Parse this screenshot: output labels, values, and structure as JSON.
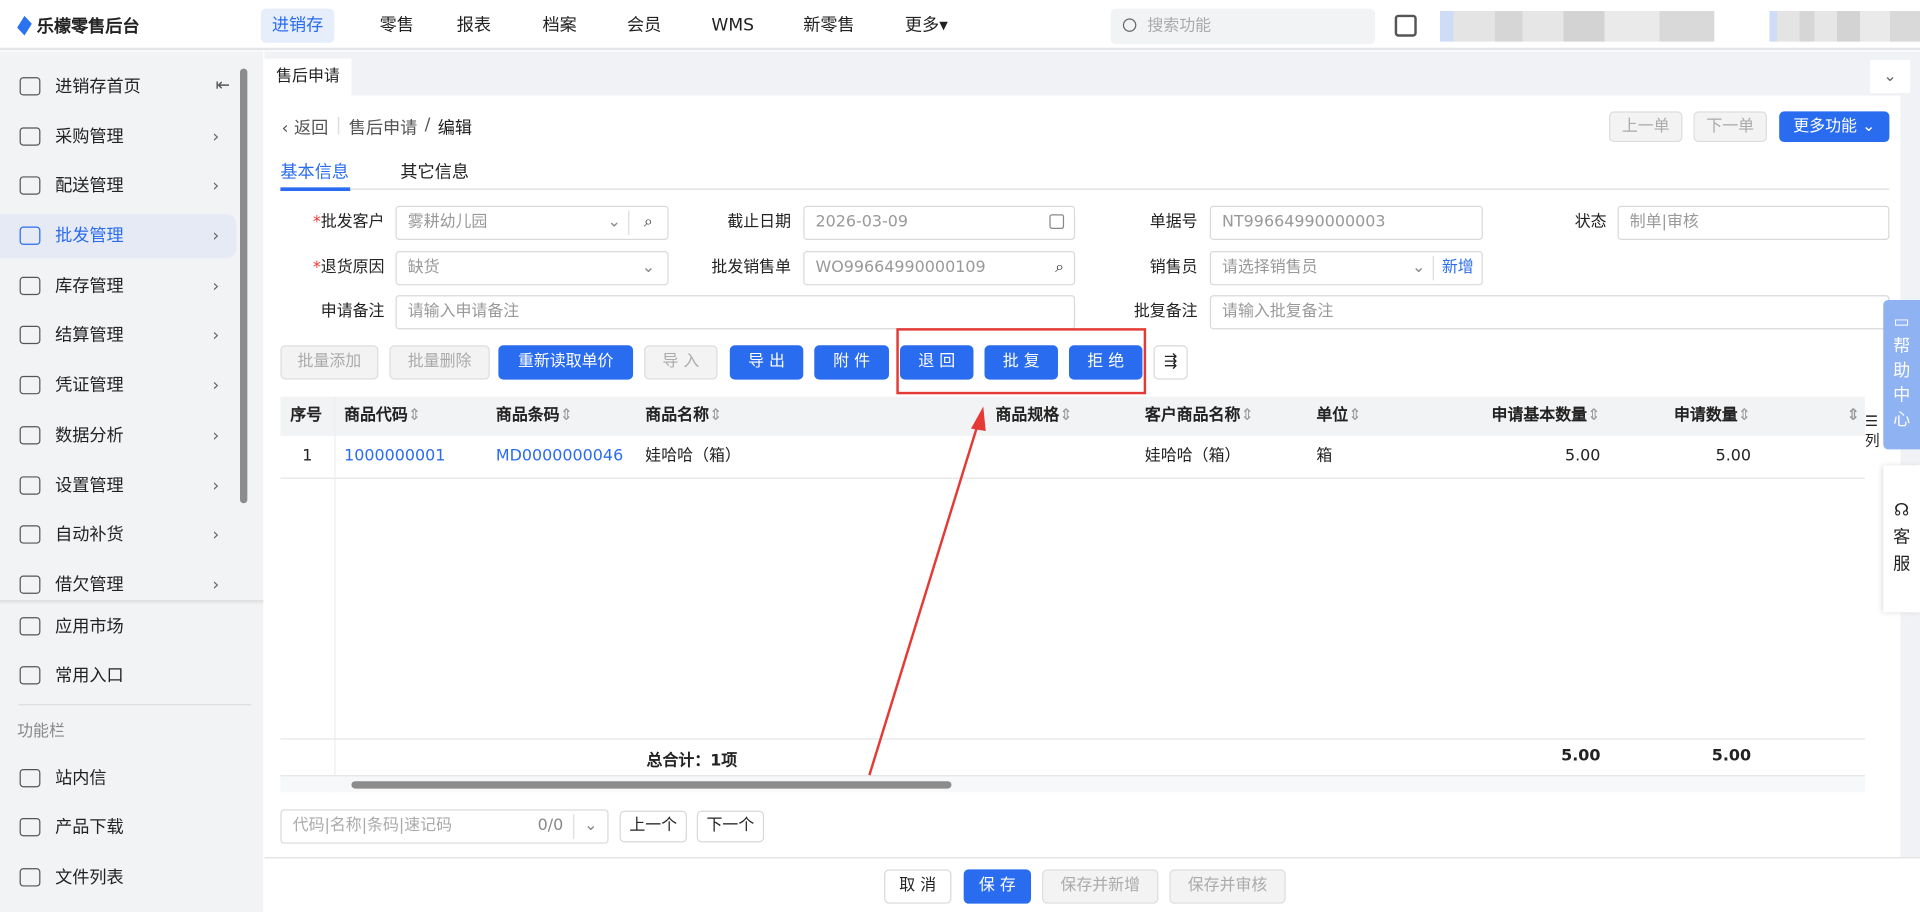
{
  "app": {
    "title": "乐檬零售后台",
    "search_placeholder": "搜索功能"
  },
  "topnav": [
    {
      "label": "进销存",
      "active": true
    },
    {
      "label": "零售"
    },
    {
      "label": "报表"
    },
    {
      "label": "档案"
    },
    {
      "label": "会员"
    },
    {
      "label": "WMS"
    },
    {
      "label": "新零售"
    },
    {
      "label": "更多▾"
    }
  ],
  "sidebar": {
    "items": [
      {
        "label": "进销存首页",
        "icon": "home-icon"
      },
      {
        "label": "采购管理",
        "icon": "cart-icon"
      },
      {
        "label": "配送管理",
        "icon": "map-icon"
      },
      {
        "label": "批发管理",
        "icon": "wholesale-icon",
        "active": true
      },
      {
        "label": "库存管理",
        "icon": "inventory-icon"
      },
      {
        "label": "结算管理",
        "icon": "dollar-icon"
      },
      {
        "label": "凭证管理",
        "icon": "voucher-icon"
      },
      {
        "label": "数据分析",
        "icon": "chart-icon"
      },
      {
        "label": "设置管理",
        "icon": "settings-icon"
      },
      {
        "label": "自动补货",
        "icon": "replenish-icon"
      },
      {
        "label": "借欠管理",
        "icon": "coins-icon"
      }
    ],
    "extra": [
      {
        "label": "应用市场",
        "icon": "app-market-icon"
      },
      {
        "label": "常用入口",
        "icon": "heart-icon"
      }
    ],
    "section_title": "功能栏",
    "tools": [
      {
        "label": "站内信",
        "icon": "mail-icon"
      },
      {
        "label": "产品下载",
        "icon": "download-icon"
      },
      {
        "label": "文件列表",
        "icon": "file-list-icon"
      }
    ]
  },
  "page_tab": "售后申请",
  "breadcrumb": {
    "back": "返回",
    "parent": "售后申请",
    "sep": "/",
    "current": "编辑"
  },
  "header_buttons": {
    "prev": "上一单",
    "next": "下一单",
    "more": "更多功能"
  },
  "tabs": [
    {
      "label": "基本信息",
      "active": true
    },
    {
      "label": "其它信息"
    }
  ],
  "form": {
    "customer": {
      "label": "批发客户",
      "value": "雾耕幼儿园"
    },
    "deadline": {
      "label": "截止日期",
      "value": "2026-03-09"
    },
    "doc_no": {
      "label": "单据号",
      "value": "NT99664990000003"
    },
    "status": {
      "label": "状态",
      "value": "制单|审核"
    },
    "reason": {
      "label": "退货原因",
      "value": "缺货"
    },
    "sales_order": {
      "label": "批发销售单",
      "value": "WO99664990000109"
    },
    "salesman": {
      "label": "销售员",
      "placeholder": "请选择销售员",
      "add": "新增"
    },
    "apply_note": {
      "label": "申请备注",
      "placeholder": "请输入申请备注"
    },
    "reply_note": {
      "label": "批复备注",
      "placeholder": "请输入批复备注"
    }
  },
  "toolbar": {
    "batch_add": "批量添加",
    "batch_delete": "批量删除",
    "reload_price": "重新读取单价",
    "import": "导 入",
    "export": "导 出",
    "attach": "附 件",
    "return": "退 回",
    "approve": "批 复",
    "reject": "拒 绝"
  },
  "table": {
    "columns": [
      "序号",
      "商品代码",
      "商品条码",
      "商品名称",
      "商品规格",
      "客户商品名称",
      "单位",
      "申请基本数量",
      "申请数量"
    ],
    "rows": [
      [
        "1",
        "1000000001",
        "MD0000000046",
        "娃哈哈（箱）",
        "",
        "娃哈哈（箱）",
        "箱",
        "5.00",
        "5.00"
      ]
    ],
    "column_settings": "列",
    "footer": {
      "total": "总合计：1项",
      "base_qty": "5.00",
      "qty": "5.00"
    }
  },
  "finder": {
    "placeholder": "代码|名称|条码|速记码",
    "count": "0/0",
    "prev": "上一个",
    "next": "下一个"
  },
  "footer_buttons": {
    "cancel": "取 消",
    "save": "保 存",
    "save_new": "保存并新增",
    "save_audit": "保存并审核"
  },
  "float": {
    "help": "帮助中心",
    "service": "客服"
  }
}
